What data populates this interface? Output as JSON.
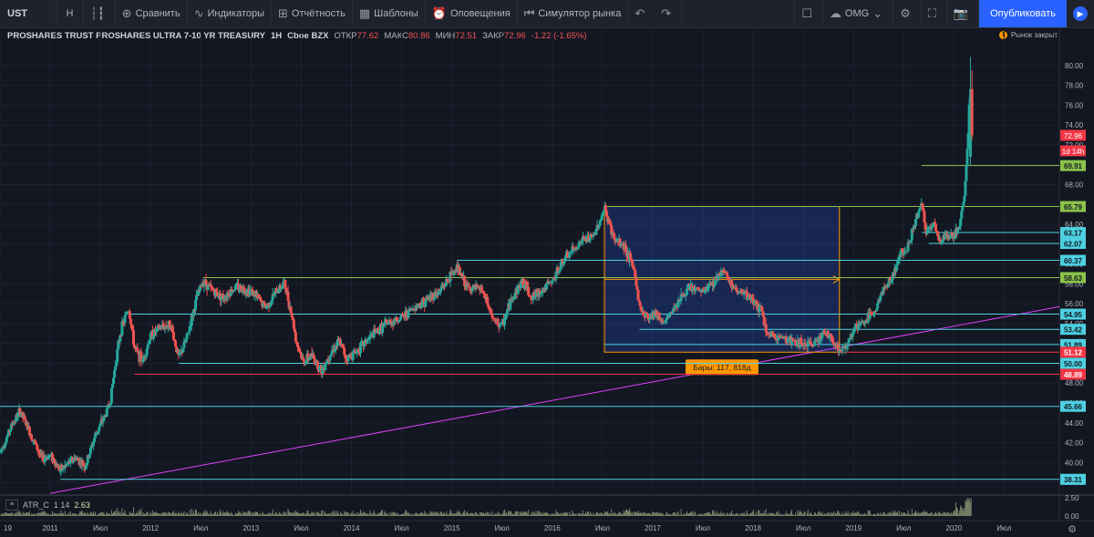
{
  "toolbar": {
    "symbol": "UST",
    "interval": "H",
    "compare": "Сравнить",
    "indicators": "Индикаторы",
    "reports": "Отчётность",
    "templates": "Шаблоны",
    "alerts": "Оповещения",
    "simulator": "Симулятор рынка",
    "layout_name": "OMG",
    "publish": "Опубликовать"
  },
  "legend": {
    "title": "PROSHARES TRUST PROSHARES ULTRA 7-10 YR TREASURY",
    "interval": "1H",
    "exchange": "Cboe BZX",
    "open_label": "ОТКР",
    "open": "77.62",
    "high_label": "МАКС",
    "high": "80.86",
    "low_label": "МИН",
    "low": "72.51",
    "close_label": "ЗАКР",
    "close": "72.96",
    "change": "-1.22 (-1.65%)",
    "market_status": "Рынок закрыт",
    "market_icon": "!"
  },
  "atr": {
    "name": "ATR_C",
    "params": "1 14",
    "value": "2.63",
    "toggle": "≡"
  },
  "measure": {
    "label": "Бары: 117, 818д"
  },
  "colors": {
    "background": "#131722",
    "up": "#26a69a",
    "down": "#ef5350",
    "green_line": "#8bc34a",
    "cyan_line": "#4dd0e1",
    "red_line": "#f23645",
    "trend": "#e040fb",
    "measure": "#ff9800"
  },
  "chart_data": {
    "type": "candlestick",
    "yaxis": {
      "range": [
        37,
        82
      ],
      "ticks": [
        38,
        40,
        42,
        44,
        46,
        48,
        50,
        52,
        54,
        56,
        58,
        60,
        62,
        64,
        66,
        68,
        70,
        72,
        74,
        76,
        78,
        80
      ],
      "tick_labels": [
        "38.00",
        "40.00",
        "42.00",
        "44.00",
        "46.00",
        "48.00",
        "50.00",
        "52.00",
        "54.00",
        "56.00",
        "58.00",
        "60.00",
        "62.00",
        "64.00",
        "66.00",
        "68.00",
        "70.00",
        "72.00",
        "74.00",
        "76.00",
        "78.00",
        "80.00"
      ]
    },
    "xaxis": {
      "range": [
        2010.5,
        2021.05
      ],
      "ticks": [
        {
          "t": 2010.5,
          "label": "19"
        },
        {
          "t": 2011.0,
          "label": "2011"
        },
        {
          "t": 2011.5,
          "label": "Июл"
        },
        {
          "t": 2012.0,
          "label": "2012"
        },
        {
          "t": 2012.5,
          "label": "Июл"
        },
        {
          "t": 2013.0,
          "label": "2013"
        },
        {
          "t": 2013.5,
          "label": "Июл"
        },
        {
          "t": 2014.0,
          "label": "2014"
        },
        {
          "t": 2014.5,
          "label": "Июл"
        },
        {
          "t": 2015.0,
          "label": "2015"
        },
        {
          "t": 2015.5,
          "label": "Июл"
        },
        {
          "t": 2016.0,
          "label": "2016"
        },
        {
          "t": 2016.5,
          "label": "Июл"
        },
        {
          "t": 2017.0,
          "label": "2017"
        },
        {
          "t": 2017.5,
          "label": "Июл"
        },
        {
          "t": 2018.0,
          "label": "2018"
        },
        {
          "t": 2018.5,
          "label": "Июл"
        },
        {
          "t": 2019.0,
          "label": "2019"
        },
        {
          "t": 2019.5,
          "label": "Июл"
        },
        {
          "t": 2020.0,
          "label": "2020"
        },
        {
          "t": 2020.5,
          "label": "Июл"
        }
      ]
    },
    "price_path": [
      [
        2010.5,
        41.0
      ],
      [
        2010.62,
        43.8
      ],
      [
        2010.7,
        45.2
      ],
      [
        2010.8,
        43.0
      ],
      [
        2010.92,
        40.3
      ],
      [
        2011.0,
        40.8
      ],
      [
        2011.1,
        39.2
      ],
      [
        2011.25,
        40.5
      ],
      [
        2011.35,
        39.6
      ],
      [
        2011.45,
        42.8
      ],
      [
        2011.55,
        44.8
      ],
      [
        2011.6,
        46.3
      ],
      [
        2011.65,
        50.0
      ],
      [
        2011.7,
        53.2
      ],
      [
        2011.78,
        55.6
      ],
      [
        2011.84,
        51.5
      ],
      [
        2011.92,
        50.2
      ],
      [
        2012.0,
        52.8
      ],
      [
        2012.1,
        53.6
      ],
      [
        2012.2,
        53.9
      ],
      [
        2012.28,
        50.5
      ],
      [
        2012.36,
        52.5
      ],
      [
        2012.46,
        56.6
      ],
      [
        2012.52,
        58.3
      ],
      [
        2012.6,
        57.5
      ],
      [
        2012.72,
        56.6
      ],
      [
        2012.85,
        57.7
      ],
      [
        2013.0,
        57.3
      ],
      [
        2013.15,
        55.6
      ],
      [
        2013.25,
        57.2
      ],
      [
        2013.33,
        58.1
      ],
      [
        2013.4,
        55.2
      ],
      [
        2013.45,
        52.3
      ],
      [
        2013.52,
        50.1
      ],
      [
        2013.6,
        50.8
      ],
      [
        2013.7,
        49.3
      ],
      [
        2013.8,
        51.2
      ],
      [
        2013.88,
        52.2
      ],
      [
        2013.95,
        50.5
      ],
      [
        2014.05,
        51.2
      ],
      [
        2014.2,
        52.8
      ],
      [
        2014.35,
        54.0
      ],
      [
        2014.5,
        54.6
      ],
      [
        2014.62,
        55.6
      ],
      [
        2014.75,
        56.4
      ],
      [
        2014.88,
        57.3
      ],
      [
        2014.95,
        58.2
      ],
      [
        2015.05,
        59.7
      ],
      [
        2015.15,
        57.6
      ],
      [
        2015.3,
        57.4
      ],
      [
        2015.42,
        54.2
      ],
      [
        2015.5,
        53.8
      ],
      [
        2015.6,
        56.6
      ],
      [
        2015.7,
        58.3
      ],
      [
        2015.8,
        56.6
      ],
      [
        2015.9,
        57.4
      ],
      [
        2016.0,
        58.2
      ],
      [
        2016.1,
        60.2
      ],
      [
        2016.2,
        61.3
      ],
      [
        2016.3,
        62.4
      ],
      [
        2016.4,
        62.6
      ],
      [
        2016.48,
        64.5
      ],
      [
        2016.52,
        65.6
      ],
      [
        2016.62,
        62.4
      ],
      [
        2016.72,
        61.8
      ],
      [
        2016.82,
        59.2
      ],
      [
        2016.87,
        55.6
      ],
      [
        2016.95,
        54.6
      ],
      [
        2017.02,
        55.2
      ],
      [
        2017.12,
        54.0
      ],
      [
        2017.25,
        56.3
      ],
      [
        2017.38,
        57.6
      ],
      [
        2017.5,
        57.2
      ],
      [
        2017.62,
        58.3
      ],
      [
        2017.7,
        59.6
      ],
      [
        2017.8,
        57.6
      ],
      [
        2017.92,
        56.8
      ],
      [
        2018.0,
        56.4
      ],
      [
        2018.08,
        55.2
      ],
      [
        2018.15,
        52.7
      ],
      [
        2018.3,
        52.6
      ],
      [
        2018.45,
        52.0
      ],
      [
        2018.58,
        51.8
      ],
      [
        2018.7,
        53.1
      ],
      [
        2018.8,
        52.3
      ],
      [
        2018.86,
        51.2
      ],
      [
        2018.92,
        51.6
      ],
      [
        2019.0,
        53.4
      ],
      [
        2019.1,
        54.1
      ],
      [
        2019.2,
        55.1
      ],
      [
        2019.3,
        57.4
      ],
      [
        2019.4,
        58.9
      ],
      [
        2019.48,
        61.4
      ],
      [
        2019.55,
        61.8
      ],
      [
        2019.62,
        64.6
      ],
      [
        2019.68,
        66.0
      ],
      [
        2019.72,
        63.2
      ],
      [
        2019.8,
        64.2
      ],
      [
        2019.87,
        62.1
      ],
      [
        2019.93,
        63.0
      ],
      [
        2020.0,
        62.6
      ],
      [
        2020.06,
        64.2
      ],
      [
        2020.1,
        66.2
      ],
      [
        2020.13,
        70.8
      ],
      [
        2020.16,
        77.5
      ],
      [
        2020.18,
        72.96
      ]
    ],
    "horizontal_levels": [
      {
        "value": 69.91,
        "color": "#8bc34a",
        "start": 2019.68,
        "label": "69.91"
      },
      {
        "value": 65.79,
        "color": "#8bc34a",
        "start": 2016.52,
        "label": "65.79"
      },
      {
        "value": 63.17,
        "color": "#4dd0e1",
        "start": 2019.68,
        "label": "63.17"
      },
      {
        "value": 62.07,
        "color": "#4dd0e1",
        "start": 2019.75,
        "label": "62.07"
      },
      {
        "value": 60.37,
        "color": "#4dd0e1",
        "start": 2015.05,
        "label": "60.37"
      },
      {
        "value": 58.63,
        "color": "#8bc34a",
        "start": 2012.52,
        "label": "58.63"
      },
      {
        "value": 54.95,
        "color": "#4dd0e1",
        "start": 2011.78,
        "label": "54.95"
      },
      {
        "value": 53.42,
        "color": "#4dd0e1",
        "start": 2016.87,
        "label": "53.42"
      },
      {
        "value": 51.89,
        "color": "#4dd0e1",
        "start": 2016.52,
        "label": "51.89"
      },
      {
        "value": 51.12,
        "color": "#f23645",
        "start": 2018.86,
        "label": "51.12"
      },
      {
        "value": 50.0,
        "color": "#4dd0e1",
        "start": 2012.28,
        "label": "50.00"
      },
      {
        "value": 48.89,
        "color": "#f23645",
        "start": 2011.84,
        "label": "48.89"
      },
      {
        "value": 45.66,
        "color": "#4dd0e1",
        "start": 2010.5,
        "label": "45.66"
      },
      {
        "value": 38.31,
        "color": "#4dd0e1",
        "start": 2011.1,
        "label": "38.31"
      }
    ],
    "price_marks": [
      {
        "value": 72.96,
        "label": "72.96",
        "bg": "#f23645"
      },
      {
        "value": 71.4,
        "label": "1d 14h",
        "bg": "#f23645"
      }
    ],
    "trendline": {
      "start": [
        2011.0,
        36.9
      ],
      "end": [
        2021.05,
        55.7
      ]
    },
    "measure_box": {
      "t0": 2016.52,
      "t1": 2018.86,
      "p0": 51.12,
      "p1": 65.79
    },
    "atr": {
      "range": [
        0,
        2.5
      ],
      "ticks": [
        0,
        2.5
      ],
      "tick_labels": [
        "0.00",
        "2.50"
      ]
    }
  }
}
